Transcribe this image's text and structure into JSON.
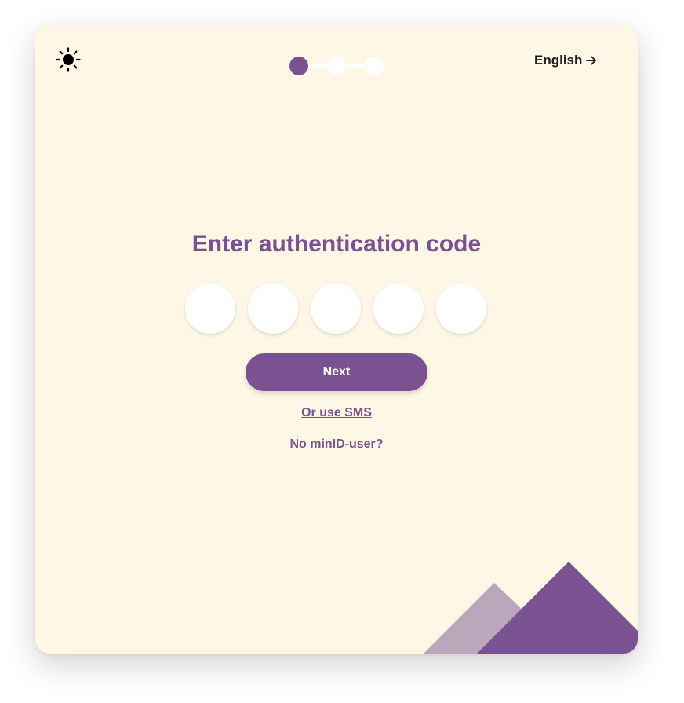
{
  "header": {
    "theme_icon": "sun-icon",
    "progress": {
      "total_steps": 3,
      "current_step": 1
    },
    "language_label": "English",
    "language_icon": "arrow-right-icon"
  },
  "main": {
    "title": "Enter authentication code",
    "code_inputs": [
      {
        "value": "",
        "placeholder": ""
      },
      {
        "value": "",
        "placeholder": ""
      },
      {
        "value": "",
        "placeholder": ""
      },
      {
        "value": "",
        "placeholder": ""
      },
      {
        "value": "",
        "placeholder": ""
      }
    ],
    "next_label": "Next",
    "sms_link": "Or use SMS",
    "no_user_link": "No minID-user?"
  },
  "colors": {
    "primary": "#7a5291",
    "primary_light": "#bba6bb",
    "card_background": "#fff7e5",
    "text_dark": "#1e1e1e"
  },
  "decoration": {
    "icon": "mountains-illustration"
  }
}
